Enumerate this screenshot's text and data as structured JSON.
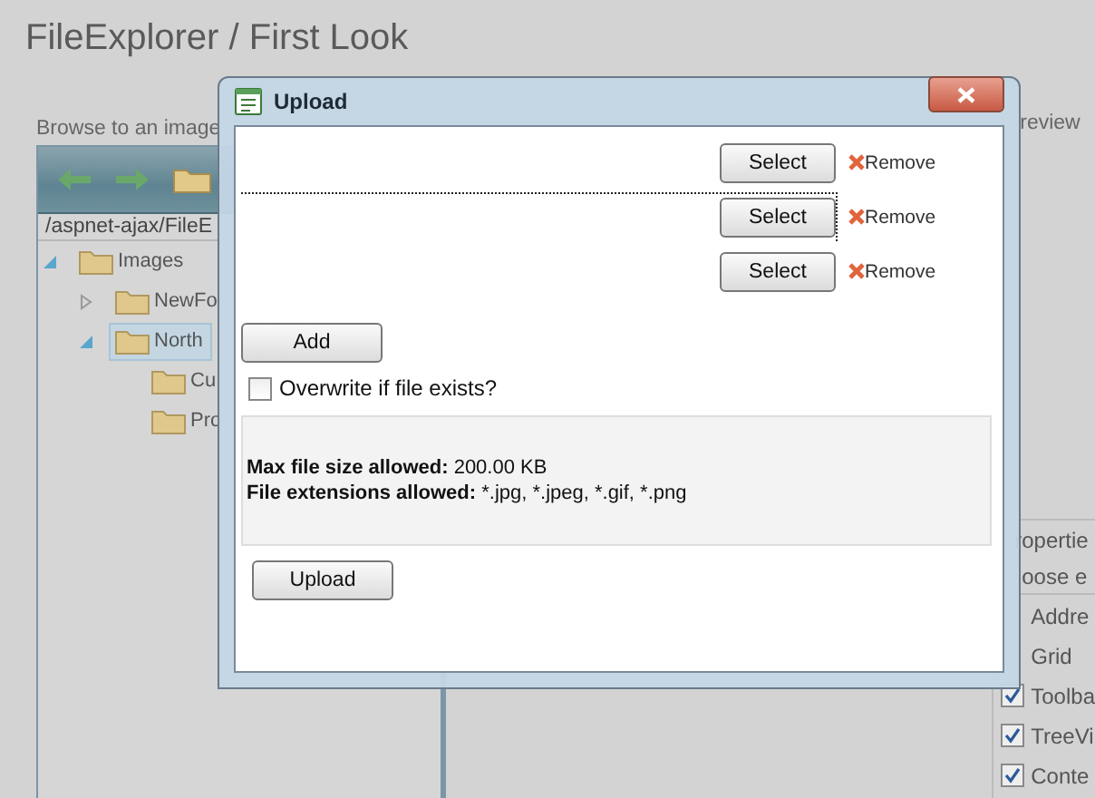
{
  "page": {
    "title": "FileExplorer / First Look",
    "browse_hint": "Browse to an image",
    "path": "/aspnet-ajax/FileE",
    "preview_label": "review",
    "tree": [
      {
        "label": "Images",
        "expanded": true,
        "selected": false,
        "children": [
          {
            "label": "NewFo",
            "expanded": false,
            "selected": false
          },
          {
            "label": "North",
            "expanded": true,
            "selected": true,
            "children": [
              {
                "label": "Cu",
                "selected": false
              },
              {
                "label": "Pro",
                "selected": false
              }
            ]
          }
        ]
      }
    ],
    "properties_title": "ropertie",
    "choose_label": "oose e",
    "options": [
      {
        "label": "Addre"
      },
      {
        "label": "Grid"
      },
      {
        "label": "Toolba",
        "checked": true
      },
      {
        "label": "TreeVi",
        "checked": true
      },
      {
        "label": "Conte",
        "checked": true
      }
    ]
  },
  "dialog": {
    "title": "Upload",
    "files": [
      {
        "select": "Select",
        "remove": "Remove",
        "focused": false
      },
      {
        "select": "Select",
        "remove": "Remove",
        "focused": true
      },
      {
        "select": "Select",
        "remove": "Remove",
        "focused": false
      }
    ],
    "add": "Add",
    "overwrite": {
      "label": "Overwrite if file exists?",
      "checked": false
    },
    "info": [
      {
        "label": "Max file size allowed:",
        "value": "200.00 KB"
      },
      {
        "label": "File extensions allowed:",
        "value": "*.jpg, *.jpeg, *.gif, *.png"
      }
    ],
    "upload": "Upload"
  }
}
